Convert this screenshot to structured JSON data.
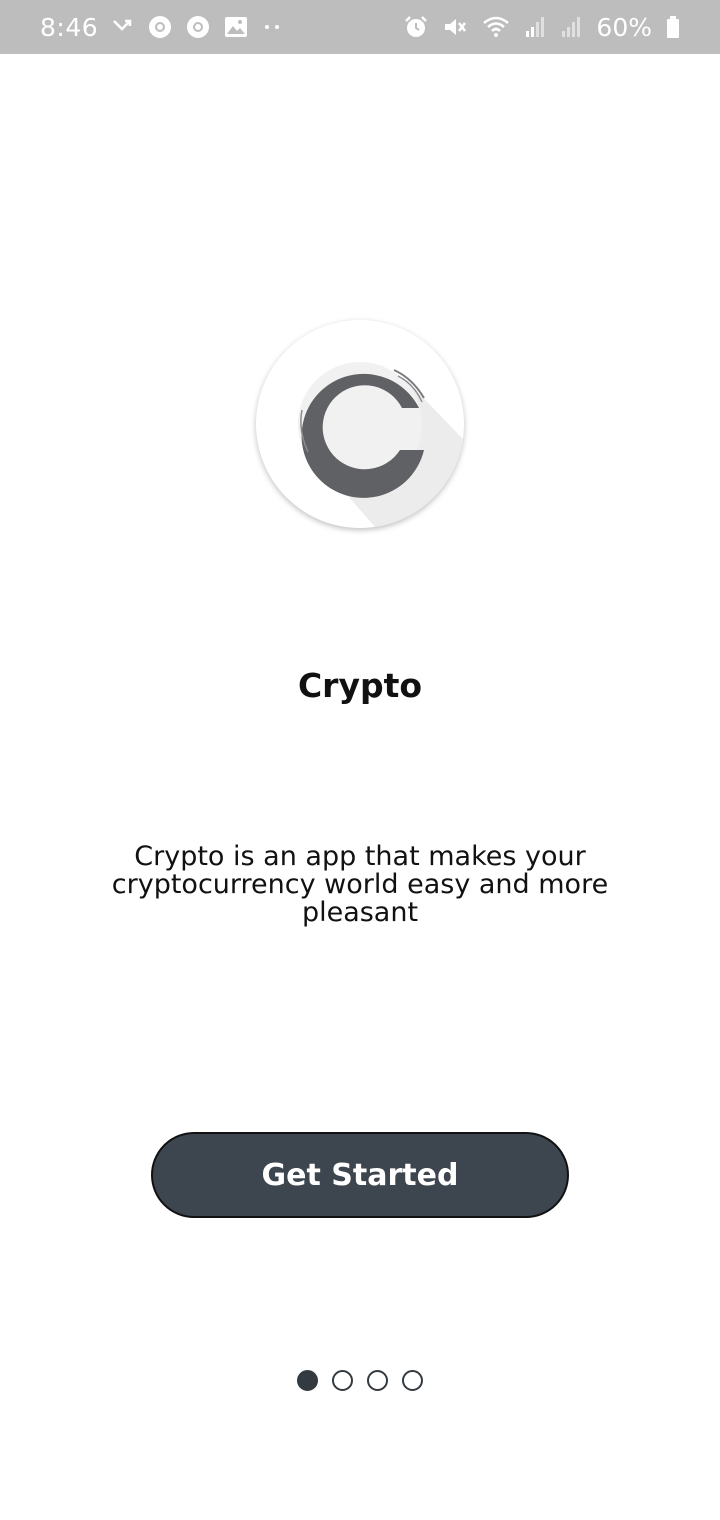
{
  "status_bar": {
    "time": "8:46",
    "battery_percent": "60%",
    "left_icons": [
      "missed-call-icon",
      "chrome-icon",
      "chrome-icon",
      "gallery-icon",
      "more-dots-icon"
    ],
    "right_icons": [
      "alarm-icon",
      "mute-icon",
      "wifi-icon",
      "signal-icon",
      "signal-icon",
      "battery-icon"
    ]
  },
  "onboarding": {
    "title": "Crypto",
    "description": "Crypto is an app that makes your cryptocurrency world easy and more pleasant",
    "cta_label": "Get Started",
    "page_count": 4,
    "active_page": 1
  },
  "colors": {
    "status_bar_bg": "#bdbdbd",
    "button_bg": "#3d464e",
    "dot_color": "#333a40",
    "logo_color": "#5f6164"
  }
}
